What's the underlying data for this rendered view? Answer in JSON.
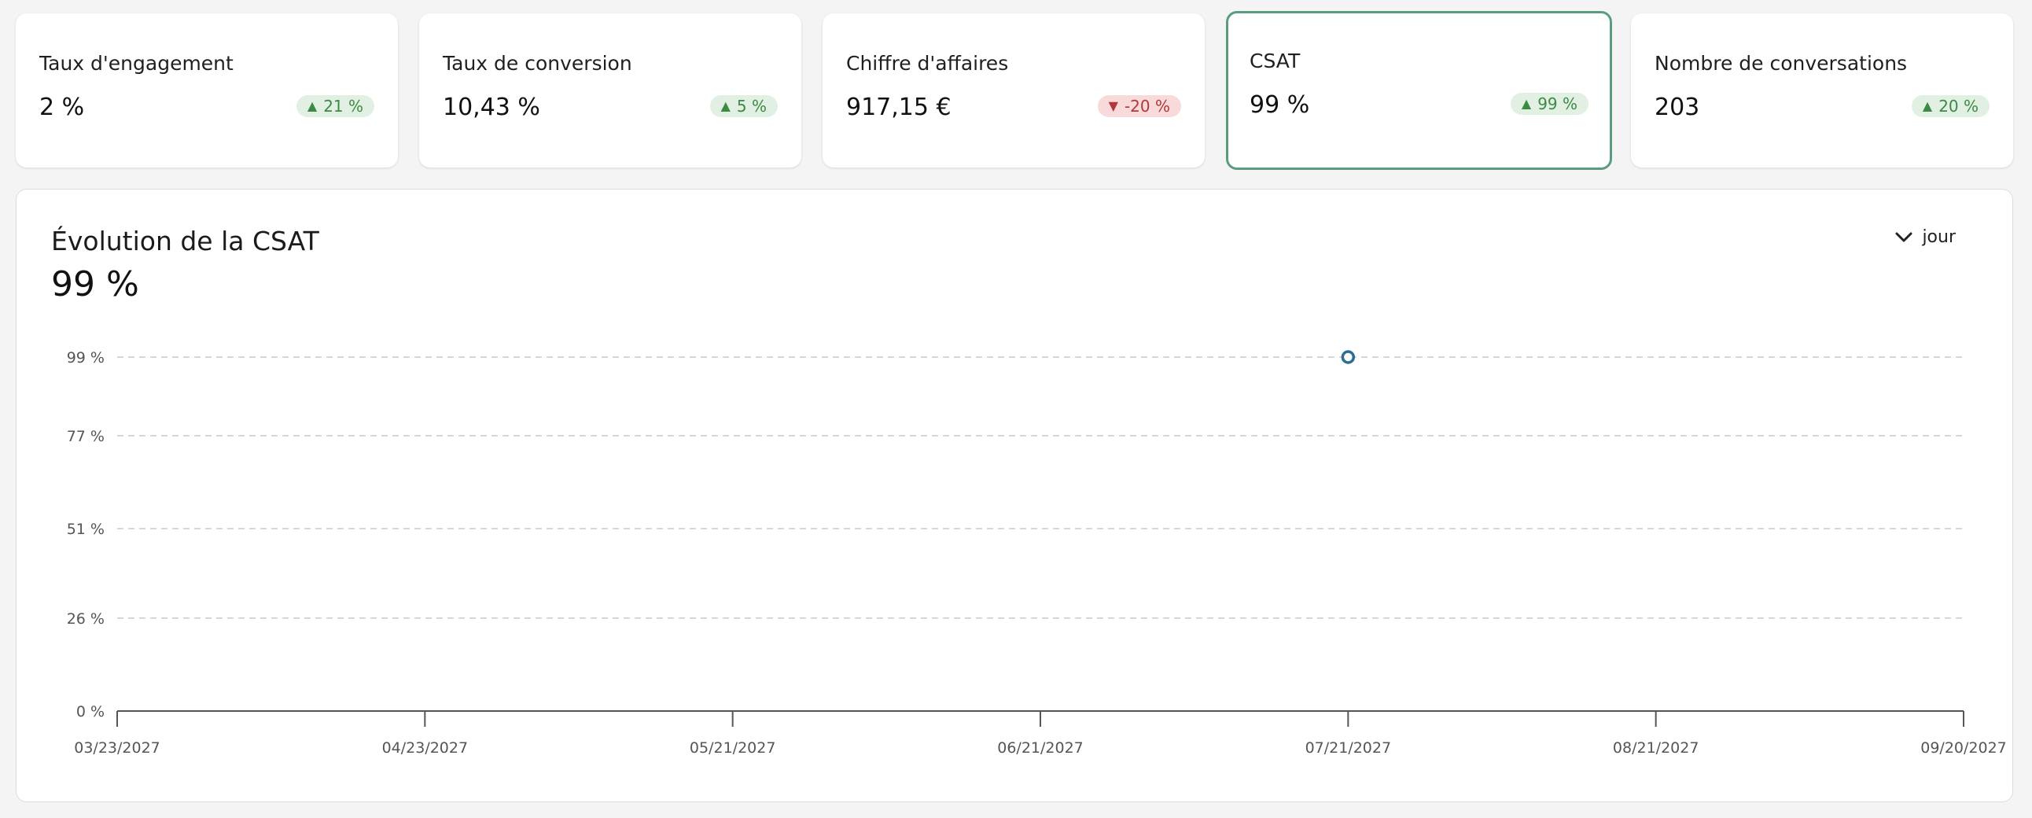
{
  "kpis": [
    {
      "label": "Taux d'engagement",
      "value": "2 %",
      "delta": "21 %",
      "trend": "up",
      "selected": false
    },
    {
      "label": "Taux de conversion",
      "value": "10,43 %",
      "delta": "5 %",
      "trend": "up",
      "selected": false
    },
    {
      "label": "Chiffre d'affaires",
      "value": "917,15 €",
      "delta": "-20 %",
      "trend": "down",
      "selected": false
    },
    {
      "label": "CSAT",
      "value": "99 %",
      "delta": "99 %",
      "trend": "up",
      "selected": true
    },
    {
      "label": "Nombre de conversations",
      "value": "203",
      "delta": "20 %",
      "trend": "up",
      "selected": false
    }
  ],
  "chart": {
    "title": "Évolution de la CSAT",
    "current_value": "99 %",
    "period": "jour",
    "icons": {
      "period_toggle": "chevron-down-icon",
      "up": "triangle-up-icon",
      "down": "triangle-down-icon"
    }
  },
  "colors": {
    "accent": "#5a9c7e",
    "up_bg": "#e1f0e3",
    "up_fg": "#3d8a43",
    "down_bg": "#f8dada",
    "down_fg": "#b2373a",
    "point": "#2d6c93"
  },
  "chart_data": {
    "type": "line",
    "title": "Évolution de la CSAT",
    "xlabel": "",
    "ylabel": "",
    "x_ticks": [
      "03/23/2027",
      "04/23/2027",
      "05/21/2027",
      "06/21/2027",
      "07/21/2027",
      "08/21/2027",
      "09/20/2027"
    ],
    "y_ticks": [
      "0 %",
      "26 %",
      "51 %",
      "77 %",
      "99 %"
    ],
    "y_tick_values": [
      0,
      26,
      51,
      77,
      99
    ],
    "ylim": [
      0,
      99
    ],
    "grid": true,
    "series": [
      {
        "points": [
          {
            "x": "07/21/2027",
            "y": 99
          }
        ]
      }
    ]
  }
}
